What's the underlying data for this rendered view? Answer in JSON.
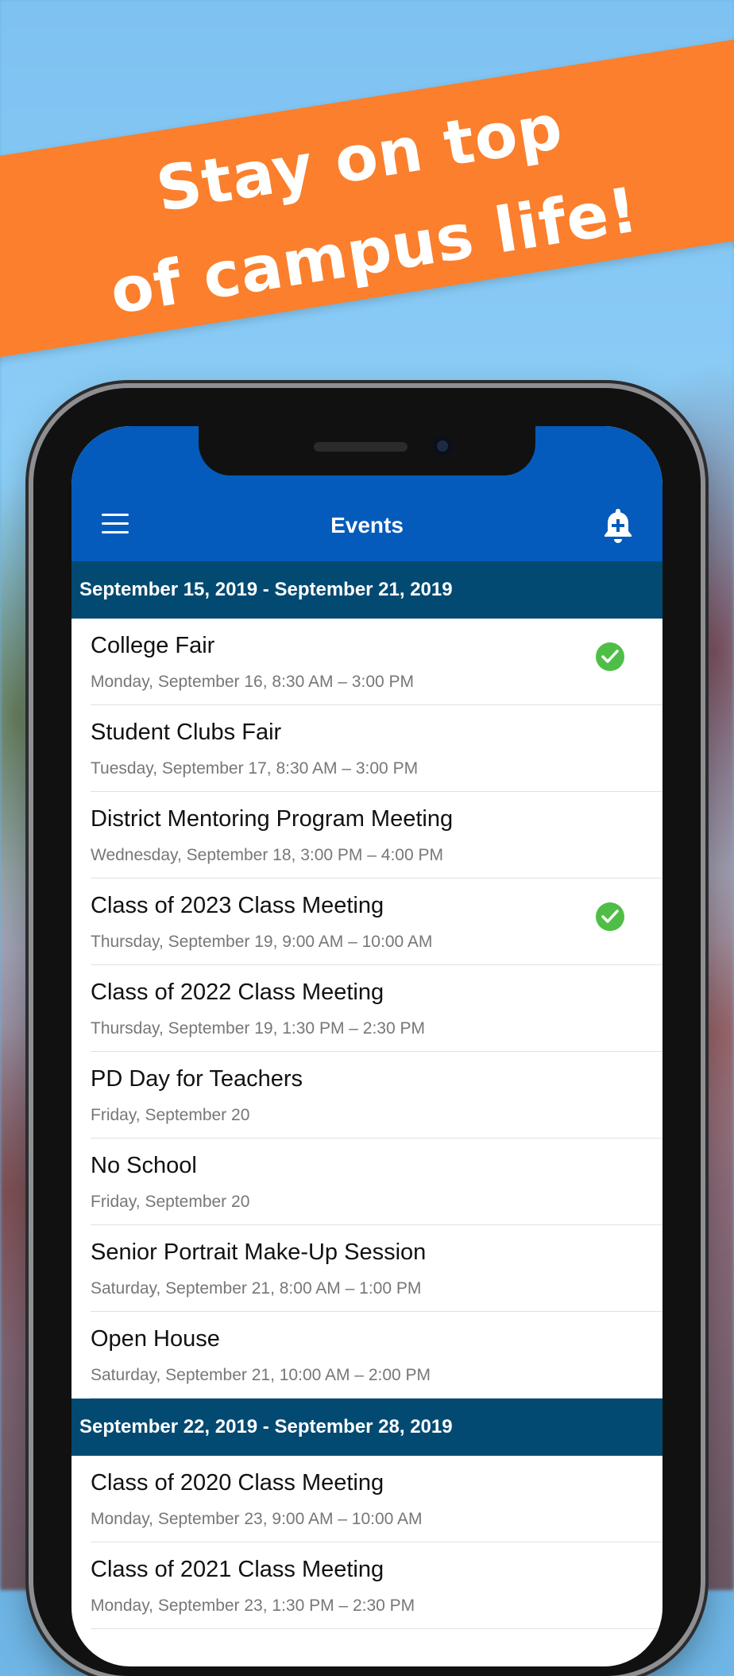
{
  "banner": {
    "line1": "Stay on top",
    "line2": "of campus life!",
    "color": "#fb7f2c"
  },
  "app": {
    "title": "Events",
    "nav_color": "#045bbb",
    "menu_icon": "hamburger-menu-icon",
    "bell_icon": "bell-add-icon"
  },
  "sections": [
    {
      "header": "September 15, 2019 - September 21, 2019",
      "events": [
        {
          "title": "College Fair",
          "time": "Monday, September 16, 8:30 AM – 3:00 PM",
          "checked": true
        },
        {
          "title": "Student Clubs Fair",
          "time": "Tuesday, September 17, 8:30 AM – 3:00 PM",
          "checked": false
        },
        {
          "title": "District Mentoring Program Meeting",
          "time": "Wednesday, September 18, 3:00 PM – 4:00 PM",
          "checked": false
        },
        {
          "title": "Class of 2023 Class Meeting",
          "time": "Thursday, September 19, 9:00 AM – 10:00 AM",
          "checked": true
        },
        {
          "title": "Class of 2022 Class Meeting",
          "time": "Thursday, September 19, 1:30 PM – 2:30 PM",
          "checked": false
        },
        {
          "title": "PD Day for Teachers",
          "time": "Friday, September 20",
          "checked": false
        },
        {
          "title": "No School",
          "time": "Friday, September 20",
          "checked": false
        },
        {
          "title": "Senior Portrait Make-Up Session",
          "time": "Saturday, September 21, 8:00 AM – 1:00 PM",
          "checked": false
        },
        {
          "title": "Open House",
          "time": "Saturday, September 21, 10:00 AM – 2:00 PM",
          "checked": false
        }
      ]
    },
    {
      "header": "September 22, 2019 - September 28, 2019",
      "events": [
        {
          "title": "Class of 2020 Class Meeting",
          "time": "Monday, September 23, 9:00 AM – 10:00 AM",
          "checked": false
        },
        {
          "title": "Class of 2021 Class Meeting",
          "time": "Monday, September 23, 1:30 PM – 2:30 PM",
          "checked": false
        }
      ]
    }
  ]
}
